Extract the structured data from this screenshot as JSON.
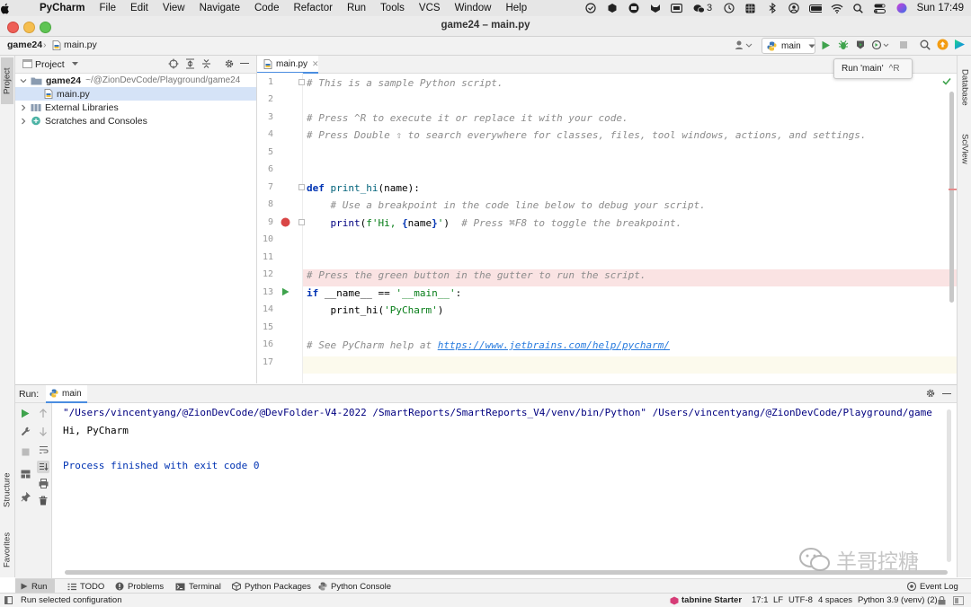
{
  "menubar": {
    "app_name": "PyCharm",
    "items": [
      "File",
      "Edit",
      "View",
      "Navigate",
      "Code",
      "Refactor",
      "Run",
      "Tools",
      "VCS",
      "Window",
      "Help"
    ],
    "wechat_count": "3",
    "clock": "Sun 17:49"
  },
  "window": {
    "title": "game24 – main.py"
  },
  "navbar": {
    "breadcrumb_project": "game24",
    "breadcrumb_file": "main.py",
    "run_config": "main",
    "tooltip": "Run 'main'",
    "tooltip_shortcut": "^R"
  },
  "side_tabs": {
    "project": "Project",
    "structure": "Structure",
    "favorites": "Favorites",
    "database": "Database",
    "sciview": "SciView"
  },
  "project_panel": {
    "title": "Project",
    "root_name": "game24",
    "root_path": "~/@ZionDevCode/Playground/game24",
    "file": "main.py",
    "external_libraries": "External Libraries",
    "scratches": "Scratches and Consoles"
  },
  "editor": {
    "tab": "main.py",
    "lines": {
      "l1_comment": "# This is a sample Python script.",
      "l3_comment": "# Press ^R to execute it or replace it with your code.",
      "l4_comment": "# Press Double ⇧ to search everywhere for classes, files, tool windows, actions, and settings.",
      "l7_def": "def",
      "l7_fn": "print_hi",
      "l7_rest": "(name):",
      "l8_comment": "# Use a breakpoint in the code line below to debug your script.",
      "l9_print": "print",
      "l9_open": "(",
      "l9_fstr1": "f'Hi, ",
      "l9_brace_open": "{",
      "l9_name": "name",
      "l9_brace_close": "}",
      "l9_fstr2": "'",
      "l9_close": ")",
      "l9_comment": "# Press ⌘F8 to toggle the breakpoint.",
      "l12_comment": "# Press the green button in the gutter to run the script.",
      "l13_if": "if",
      "l13_name": "__name__",
      "l13_eq": " == ",
      "l13_str": "'__main__'",
      "l13_colon": ":",
      "l14_call": "print_hi",
      "l14_open": "(",
      "l14_str": "'PyCharm'",
      "l14_close": ")",
      "l16_comment": "# See PyCharm help at ",
      "l16_link": "https://www.jetbrains.com/help/pycharm/"
    },
    "line_numbers": [
      "1",
      "2",
      "3",
      "4",
      "5",
      "6",
      "7",
      "8",
      "9",
      "10",
      "11",
      "12",
      "13",
      "14",
      "15",
      "16",
      "17"
    ]
  },
  "run_panel": {
    "label": "Run:",
    "tab": "main",
    "output": [
      "\"/Users/vincentyang/@ZionDevCode/@DevFolder-V4-2022 /SmartReports/SmartReports_V4/venv/bin/Python\" /Users/vincentyang/@ZionDevCode/Playground/game",
      "Hi, PyCharm",
      "",
      "Process finished with exit code 0"
    ]
  },
  "bottom_tabs": [
    "Run",
    "TODO",
    "Problems",
    "Terminal",
    "Python Packages",
    "Python Console"
  ],
  "event_log": "Event Log",
  "watermark": "羊哥控糖",
  "status": {
    "message": "Run selected configuration",
    "tabnine": "tabnine Starter",
    "position": "17:1",
    "line_sep": "LF",
    "encoding": "UTF-8",
    "indent": "4 spaces",
    "interpreter": "Python 3.9 (venv) (2)"
  },
  "colors": {
    "accent": "#4a8de0",
    "breakpoint": "#d94646",
    "run_green": "#3fa34d",
    "keyword": "#0033b3",
    "string": "#067d17",
    "comment": "#8c8c8c",
    "selection": "#d5e3f7"
  }
}
